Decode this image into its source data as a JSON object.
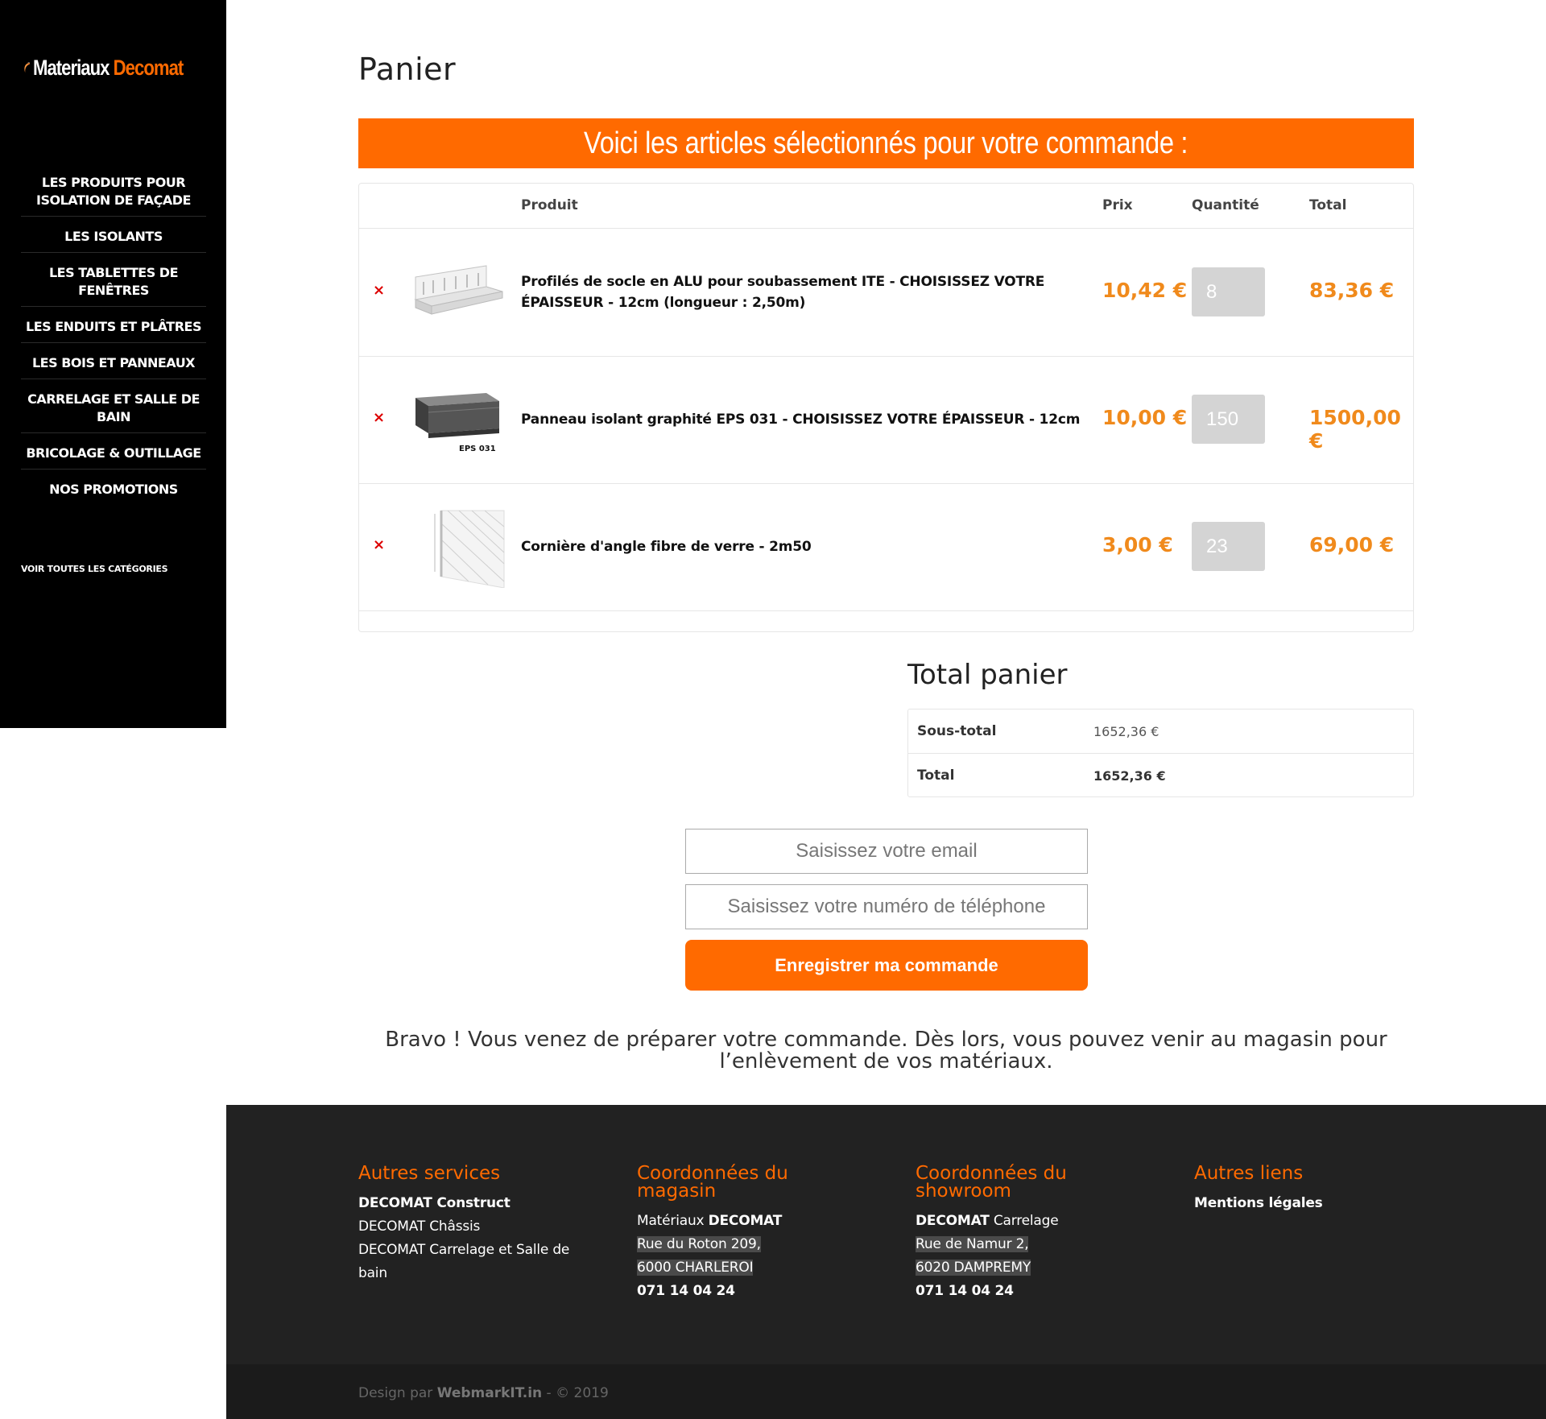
{
  "sidebar": {
    "logo": {
      "part1": "Materiaux",
      "part2": "Decomat"
    },
    "nav": [
      {
        "label": "LES PRODUITS POUR ISOLATION DE FAÇADE"
      },
      {
        "label": "LES ISOLANTS"
      },
      {
        "label": "LES TABLETTES DE FENÊTRES"
      },
      {
        "label": "LES ENDUITS ET PLÂTRES"
      },
      {
        "label": "LES BOIS ET PANNEAUX"
      },
      {
        "label": "CARRELAGE ET SALLE DE BAIN"
      },
      {
        "label": "BRICOLAGE & OUTILLAGE"
      },
      {
        "label": "NOS PROMOTIONS"
      }
    ],
    "all_categories": "VOIR TOUTES LES CATÉGORIES"
  },
  "page_title": "Panier",
  "banner": "Voici les articles sélectionnés pour votre commande :",
  "cart": {
    "headers": {
      "product": "Produit",
      "price": "Prix",
      "quantity": "Quantité",
      "total": "Total"
    },
    "remove_symbol": "×",
    "items": [
      {
        "name": "Profilés de socle en ALU pour soubassement ITE - CHOISISSEZ VOTRE ÉPAISSEUR - 12cm (longueur : 2,50m)",
        "price": "10,42 €",
        "qty": "8",
        "total": "83,36 €",
        "image": "aluminium-profile-image"
      },
      {
        "name": "Panneau isolant graphité EPS 031 - CHOISISSEZ VOTRE ÉPAISSEUR - 12cm",
        "price": "10,00 €",
        "qty": "150",
        "total": "1500,00 €",
        "image": "insulation-panel-image",
        "image_caption": "EPS 031"
      },
      {
        "name": "Cornière d'angle fibre de verre - 2m50",
        "price": "3,00 €",
        "qty": "23",
        "total": "69,00 €",
        "image": "corner-bead-image"
      }
    ]
  },
  "totals": {
    "title": "Total panier",
    "subtotal_label": "Sous-total",
    "subtotal_value": "1652,36 €",
    "total_label": "Total",
    "total_value": "1652,36 €"
  },
  "form": {
    "email_placeholder": "Saisissez votre email",
    "phone_placeholder": "Saisissez votre numéro de téléphone",
    "submit_label": "Enregistrer ma commande"
  },
  "bravo_text": "Bravo ! Vous venez de préparer votre commande. Dès lors, vous pouvez venir au magasin pour l’enlèvement de vos matériaux.",
  "footer": {
    "col1": {
      "title": "Autres services",
      "l1": "DECOMAT Construct",
      "l2": "DECOMAT Châssis",
      "l3": "DECOMAT Carrelage et Salle de bain"
    },
    "col2": {
      "title": "Coordonnées du magasin",
      "l1a": "Matériaux ",
      "l1b": "DECOMAT",
      "l2": "Rue du Roton 209,",
      "l3": "6000 CHARLEROI",
      "l4": "071 14 04 24"
    },
    "col3": {
      "title": "Coordonnées du showroom",
      "l1a": "DECOMAT",
      "l1b": " Carrelage",
      "l2": "Rue de Namur 2,",
      "l3": "6020 DAMPREMY",
      "l4": "071 14 04 24"
    },
    "col4": {
      "title": "Autres liens",
      "l1": "Mentions légales"
    },
    "credit_prefix": "Design par ",
    "credit_brand": "WebmarkIT.in",
    "credit_suffix": " - © 2019"
  },
  "colors": {
    "accent": "#ff6a00",
    "price": "#f08a1c",
    "remove": "#dd0000",
    "sidebar_bg": "#000000",
    "footer_bg": "#222222"
  }
}
